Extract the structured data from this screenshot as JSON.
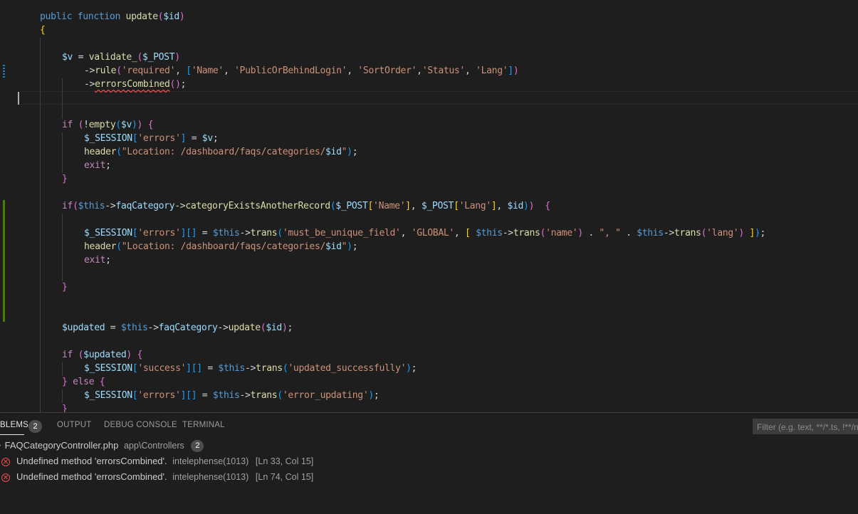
{
  "editor": {
    "lines": [
      [
        [
          "public ",
          "kw"
        ],
        [
          "function ",
          "kw"
        ],
        [
          "update",
          "fn"
        ],
        [
          "(",
          "b2"
        ],
        [
          "$id",
          "var"
        ],
        [
          ")",
          "b2"
        ]
      ],
      [
        [
          "{",
          "b1"
        ]
      ],
      [],
      [
        [
          "$v",
          "var"
        ],
        [
          " = "
        ],
        [
          "validate_",
          "fn"
        ],
        [
          "(",
          "b2"
        ],
        [
          "$_POST",
          "var"
        ],
        [
          ")",
          "b2"
        ]
      ],
      [
        [
          "->"
        ],
        [
          "rule",
          "fn"
        ],
        [
          "(",
          "b2"
        ],
        [
          "'required'",
          "str"
        ],
        [
          ", "
        ],
        [
          "[",
          "b3"
        ],
        [
          "'Name'",
          "str"
        ],
        [
          ", "
        ],
        [
          "'PublicOrBehindLogin'",
          "str"
        ],
        [
          ", "
        ],
        [
          "'SortOrder'",
          "str"
        ],
        [
          ","
        ],
        [
          "'Status'",
          "str"
        ],
        [
          ", "
        ],
        [
          "'Lang'",
          "str"
        ],
        [
          "]",
          "b3"
        ],
        [
          ")",
          "b2"
        ]
      ],
      [
        [
          "->"
        ],
        [
          "errorsCombined",
          "fn squiggle"
        ],
        [
          "(",
          "b2"
        ],
        [
          ")",
          "b2"
        ],
        [
          ";"
        ]
      ],
      [],
      [],
      [
        [
          "if ",
          "ctrl"
        ],
        [
          "(",
          "b2"
        ],
        [
          "!"
        ],
        [
          "empty",
          "fn"
        ],
        [
          "(",
          "b3"
        ],
        [
          "$v",
          "var"
        ],
        [
          ")",
          "b3"
        ],
        [
          ")",
          "b2"
        ],
        [
          " "
        ],
        [
          "{",
          "b2"
        ]
      ],
      [
        [
          "$_SESSION",
          "var"
        ],
        [
          "[",
          "b3"
        ],
        [
          "'errors'",
          "str"
        ],
        [
          "]",
          "b3"
        ],
        [
          " = "
        ],
        [
          "$v",
          "var"
        ],
        [
          ";"
        ]
      ],
      [
        [
          "header",
          "fn"
        ],
        [
          "(",
          "b3"
        ],
        [
          "\"Location: /dashboard/faqs/categories/",
          "str"
        ],
        [
          "$id",
          "var"
        ],
        [
          "\"",
          "str"
        ],
        [
          ")",
          "b3"
        ],
        [
          ";"
        ]
      ],
      [
        [
          "exit",
          "ctrl"
        ],
        [
          ";"
        ]
      ],
      [
        [
          "}",
          "b2"
        ]
      ],
      [],
      [
        [
          "if",
          "ctrl"
        ],
        [
          "(",
          "b2"
        ],
        [
          "$this",
          "kw"
        ],
        [
          "->"
        ],
        [
          "faqCategory",
          "var"
        ],
        [
          "->"
        ],
        [
          "categoryExistsAnotherRecord",
          "fn"
        ],
        [
          "(",
          "b3"
        ],
        [
          "$_POST",
          "var"
        ],
        [
          "[",
          "b1"
        ],
        [
          "'Name'",
          "str"
        ],
        [
          "]",
          "b1"
        ],
        [
          ", "
        ],
        [
          "$_POST",
          "var"
        ],
        [
          "[",
          "b1"
        ],
        [
          "'Lang'",
          "str"
        ],
        [
          "]",
          "b1"
        ],
        [
          ", "
        ],
        [
          "$id",
          "var"
        ],
        [
          ")",
          "b3"
        ],
        [
          ")",
          "b2"
        ],
        [
          "  "
        ],
        [
          "{",
          "b2"
        ]
      ],
      [],
      [
        [
          "$_SESSION",
          "var"
        ],
        [
          "[",
          "b3"
        ],
        [
          "'errors'",
          "str"
        ],
        [
          "]",
          "b3"
        ],
        [
          "[",
          "b3"
        ],
        [
          "]",
          "b3"
        ],
        [
          " = "
        ],
        [
          "$this",
          "kw"
        ],
        [
          "->"
        ],
        [
          "trans",
          "fn"
        ],
        [
          "(",
          "b3"
        ],
        [
          "'must_be_unique_field'",
          "str"
        ],
        [
          ", "
        ],
        [
          "'GLOBAL'",
          "str"
        ],
        [
          ", "
        ],
        [
          "[",
          "b1"
        ],
        [
          " "
        ],
        [
          "$this",
          "kw"
        ],
        [
          "->"
        ],
        [
          "trans",
          "fn"
        ],
        [
          "(",
          "b2"
        ],
        [
          "'name'",
          "str"
        ],
        [
          ")",
          "b2"
        ],
        [
          " . "
        ],
        [
          "\", \"",
          "str"
        ],
        [
          " . "
        ],
        [
          "$this",
          "kw"
        ],
        [
          "->"
        ],
        [
          "trans",
          "fn"
        ],
        [
          "(",
          "b2"
        ],
        [
          "'lang'",
          "str"
        ],
        [
          ")",
          "b2"
        ],
        [
          " "
        ],
        [
          "]",
          "b1"
        ],
        [
          ")",
          "b3"
        ],
        [
          ";"
        ]
      ],
      [
        [
          "header",
          "fn"
        ],
        [
          "(",
          "b3"
        ],
        [
          "\"Location: /dashboard/faqs/categories/",
          "str"
        ],
        [
          "$id",
          "var"
        ],
        [
          "\"",
          "str"
        ],
        [
          ")",
          "b3"
        ],
        [
          ";"
        ]
      ],
      [
        [
          "exit",
          "ctrl"
        ],
        [
          ";"
        ]
      ],
      [],
      [
        [
          "}",
          "b2"
        ]
      ],
      [],
      [],
      [
        [
          "$updated",
          "var"
        ],
        [
          " = "
        ],
        [
          "$this",
          "kw"
        ],
        [
          "->"
        ],
        [
          "faqCategory",
          "var"
        ],
        [
          "->"
        ],
        [
          "update",
          "fn"
        ],
        [
          "(",
          "b2"
        ],
        [
          "$id",
          "var"
        ],
        [
          ")",
          "b2"
        ],
        [
          ";"
        ]
      ],
      [],
      [
        [
          "if ",
          "ctrl"
        ],
        [
          "(",
          "b2"
        ],
        [
          "$updated",
          "var"
        ],
        [
          ")",
          "b2"
        ],
        [
          " "
        ],
        [
          "{",
          "b2"
        ]
      ],
      [
        [
          "$_SESSION",
          "var"
        ],
        [
          "[",
          "b3"
        ],
        [
          "'success'",
          "str"
        ],
        [
          "]",
          "b3"
        ],
        [
          "[",
          "b3"
        ],
        [
          "]",
          "b3"
        ],
        [
          " = "
        ],
        [
          "$this",
          "kw"
        ],
        [
          "->"
        ],
        [
          "trans",
          "fn"
        ],
        [
          "(",
          "b3"
        ],
        [
          "'updated_successfully'",
          "str"
        ],
        [
          ")",
          "b3"
        ],
        [
          ";"
        ]
      ],
      [
        [
          "}",
          "b2"
        ],
        [
          " "
        ],
        [
          "else ",
          "ctrl"
        ],
        [
          "{",
          "b2"
        ]
      ],
      [
        [
          "$_SESSION",
          "var"
        ],
        [
          "[",
          "b3"
        ],
        [
          "'errors'",
          "str"
        ],
        [
          "]",
          "b3"
        ],
        [
          "[",
          "b3"
        ],
        [
          "]",
          "b3"
        ],
        [
          " = "
        ],
        [
          "$this",
          "kw"
        ],
        [
          "->"
        ],
        [
          "trans",
          "fn"
        ],
        [
          "(",
          "b3"
        ],
        [
          "'error_updating'",
          "str"
        ],
        [
          ")",
          "b3"
        ],
        [
          ";"
        ]
      ],
      [
        [
          "}",
          "b2"
        ]
      ]
    ]
  },
  "panel": {
    "tabs": [
      {
        "label": "BLEMS",
        "active": true
      },
      {
        "label": "OUTPUT",
        "active": false
      },
      {
        "label": "DEBUG CONSOLE",
        "active": false
      },
      {
        "label": "TERMINAL",
        "active": false
      }
    ],
    "problems_count": "2",
    "filter_placeholder": "Filter (e.g. text, **/*.ts, !**/node_modules/**)",
    "file": {
      "name": "FAQCategoryController.php",
      "path": "app\\Controllers",
      "count": "2"
    },
    "problems": [
      {
        "message": "Undefined method 'errorsCombined'.",
        "source": "intelephense(1013)",
        "location": "[Ln 33, Col 15]"
      },
      {
        "message": "Undefined method 'errorsCombined'.",
        "source": "intelephense(1013)",
        "location": "[Ln 74, Col 15]"
      }
    ]
  }
}
